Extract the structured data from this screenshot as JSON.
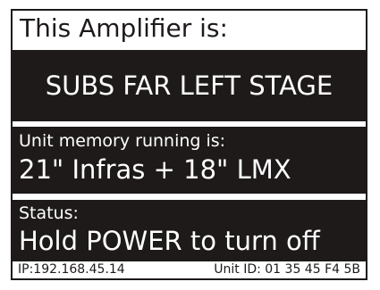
{
  "header": {
    "title": "This Amplifier is:"
  },
  "amplifier": {
    "name": "SUBS FAR LEFT STAGE"
  },
  "memory": {
    "label": "Unit memory running is:",
    "value": "21\" Infras + 18\" LMX"
  },
  "status": {
    "label": "Status:",
    "value": "Hold POWER to turn off"
  },
  "footer": {
    "ip": "IP:192.168.45.14",
    "unit_id": "Unit ID: 01 35 45 F4 5B"
  },
  "colors": {
    "panel": "#1e1a1a",
    "background": "#ffffff",
    "text_on_panel": "#ffffff"
  }
}
